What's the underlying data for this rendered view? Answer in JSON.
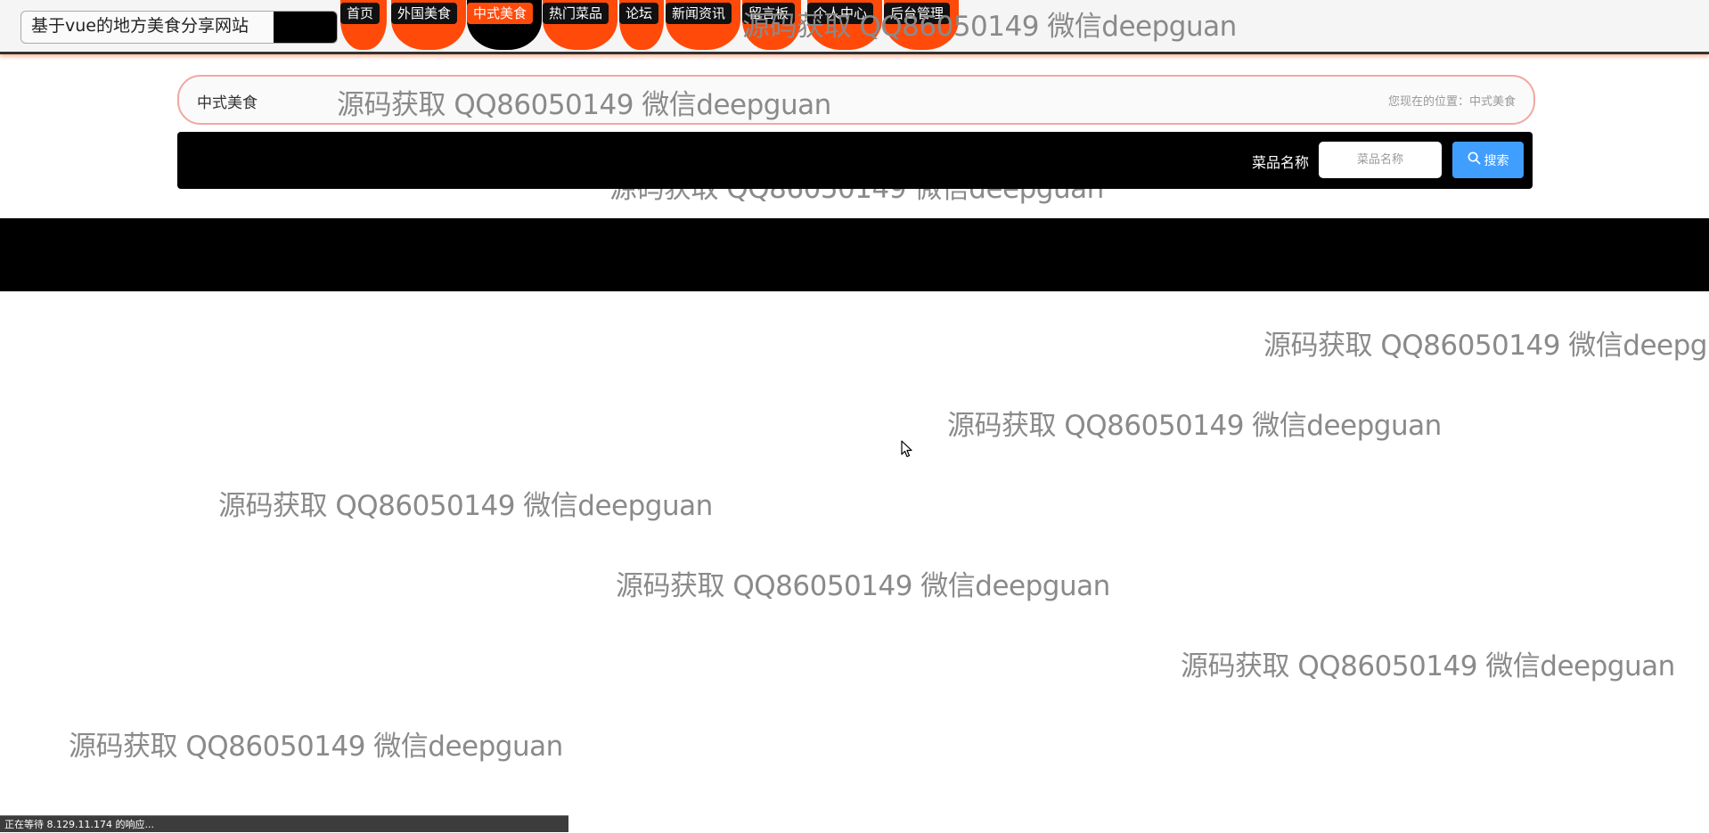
{
  "header": {
    "site_title": "基于vue的地方美食分享网站",
    "nav": [
      {
        "label": "首页"
      },
      {
        "label": "外国美食"
      },
      {
        "label": "中式美食"
      },
      {
        "label": "热门菜品"
      },
      {
        "label": "论坛"
      },
      {
        "label": "新闻资讯"
      },
      {
        "label": "留言板"
      },
      {
        "label": "个人中心"
      },
      {
        "label": "后台管理"
      }
    ],
    "active_nav": "中式美食"
  },
  "watermark_text": "源码获取 QQ86050149 微信deepguan",
  "breadcrumb": {
    "title": "中式美食",
    "location": "您现在的位置：中式美食"
  },
  "search": {
    "label": "菜品名称",
    "placeholder": "菜品名称",
    "value": "",
    "button_label": "搜索",
    "button_icon": "search-icon"
  },
  "status_bar": {
    "text": "正在等待 8.129.11.174 的响应..."
  },
  "colors": {
    "accent": "#ff4a0a",
    "search_button": "#409eff",
    "breadcrumb_border": "#f1a8a0"
  }
}
